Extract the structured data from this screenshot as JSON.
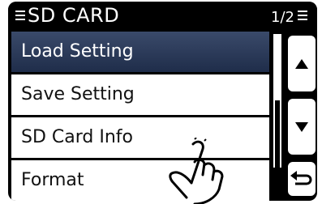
{
  "title_bar": {
    "title": "SD CARD",
    "page_indicator": "1/2"
  },
  "menu": {
    "items": [
      {
        "label": "Load Setting",
        "selected": true
      },
      {
        "label": "Save Setting",
        "selected": false
      },
      {
        "label": "SD Card Info",
        "selected": false
      },
      {
        "label": "Format",
        "selected": false
      }
    ]
  },
  "buttons": {
    "up_icon": "triangle-up",
    "down_icon": "triangle-down",
    "back_icon": "return-arrow"
  },
  "colors": {
    "selected_row": "#2a3856",
    "background": "#000000",
    "row_background": "#ffffff"
  }
}
